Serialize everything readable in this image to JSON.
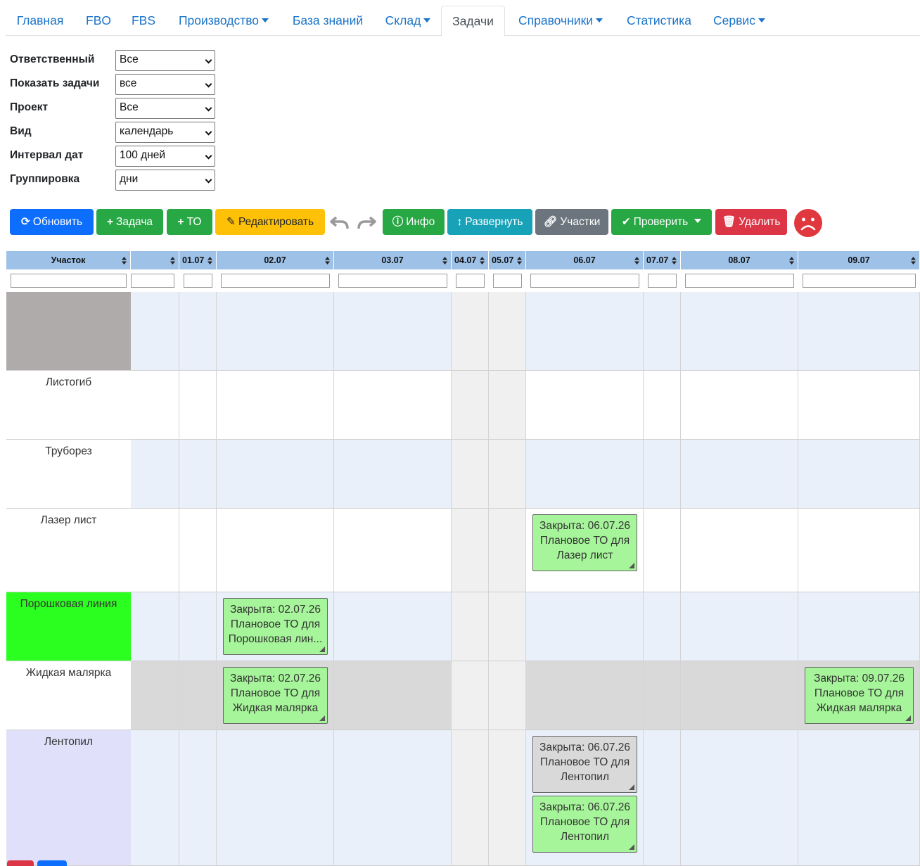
{
  "nav": {
    "tabs": [
      {
        "label": "Главная"
      },
      {
        "label": "FBO"
      },
      {
        "label": "FBS"
      },
      {
        "label": "Производство",
        "dropdown": true
      },
      {
        "label": "База знаний"
      },
      {
        "label": "Склад",
        "dropdown": true
      },
      {
        "label": "Задачи",
        "active": true
      },
      {
        "label": "Справочники",
        "dropdown": true
      },
      {
        "label": "Статистика"
      },
      {
        "label": "Сервис",
        "dropdown": true
      }
    ]
  },
  "filters": [
    {
      "label": "Ответственный",
      "value": "Все"
    },
    {
      "label": "Показать задачи",
      "value": "все"
    },
    {
      "label": "Проект",
      "value": "Все"
    },
    {
      "label": "Вид",
      "value": "календарь"
    },
    {
      "label": "Интервал дат",
      "value": "100 дней"
    },
    {
      "label": "Группировка",
      "value": "дни"
    }
  ],
  "toolbar": {
    "refresh": "Обновить",
    "task": "Задача",
    "to": "ТО",
    "edit": "Редактировать",
    "info": "Инфо",
    "expand": "Развернуть",
    "sections": "Участки",
    "check": "Проверить",
    "delete": "Удалить"
  },
  "grid": {
    "columns": [
      {
        "label": "Участок"
      },
      {
        "label": ""
      },
      {
        "label": "01.07"
      },
      {
        "label": "02.07"
      },
      {
        "label": "03.07"
      },
      {
        "label": "04.07"
      },
      {
        "label": "05.07"
      },
      {
        "label": "06.07"
      },
      {
        "label": "07.07"
      },
      {
        "label": "08.07"
      },
      {
        "label": "09.07"
      }
    ],
    "rows": [
      {
        "label": "",
        "label_bg": "#b0abab"
      },
      {
        "label": "Листогиб",
        "label_bg": "#ffffff"
      },
      {
        "label": "Труборез",
        "label_bg": "#ffffff"
      },
      {
        "label": "Лазер лист",
        "label_bg": "#ffffff"
      },
      {
        "label": "Порошковая линия",
        "label_bg": "#2bff1f"
      },
      {
        "label": "Жидкая малярка",
        "label_bg": "#ffffff"
      },
      {
        "label": "Лентопил",
        "label_bg": "#e0e0fa"
      }
    ],
    "cards": [
      {
        "row": 3,
        "col": 7,
        "color": "green",
        "lines": [
          "Закрыта: 06.07.26",
          "Плановое ТО для",
          "Лазер лист"
        ]
      },
      {
        "row": 4,
        "col": 3,
        "color": "green",
        "lines": [
          "Закрыта: 02.07.26",
          "Плановое ТО для",
          "Порошковая лин..."
        ]
      },
      {
        "row": 5,
        "col": 3,
        "color": "green",
        "lines": [
          "Закрыта: 02.07.26",
          "Плановое ТО для",
          "Жидкая малярка"
        ]
      },
      {
        "row": 5,
        "col": 10,
        "color": "green",
        "lines": [
          "Закрыта: 09.07.26",
          "Плановое ТО для",
          "Жидкая малярка"
        ]
      },
      {
        "row": 6,
        "col": 7,
        "color": "gray",
        "lines": [
          "Закрыта: 06.07.26",
          "Плановое ТО для",
          "Лентопил"
        ]
      },
      {
        "row": 6,
        "col": 7,
        "color": "green",
        "lines": [
          "Закрыта: 06.07.26",
          "Плановое ТО для",
          "Лентопил"
        ]
      }
    ]
  },
  "colors": {
    "header_bg": "#9ec1e8",
    "band_blue": "#e9f0fa",
    "weekend": "#f0f0f0",
    "highlight_row": "#d9d9d9",
    "card_green": "#a6f59a",
    "card_gray": "#d9d9d9"
  }
}
